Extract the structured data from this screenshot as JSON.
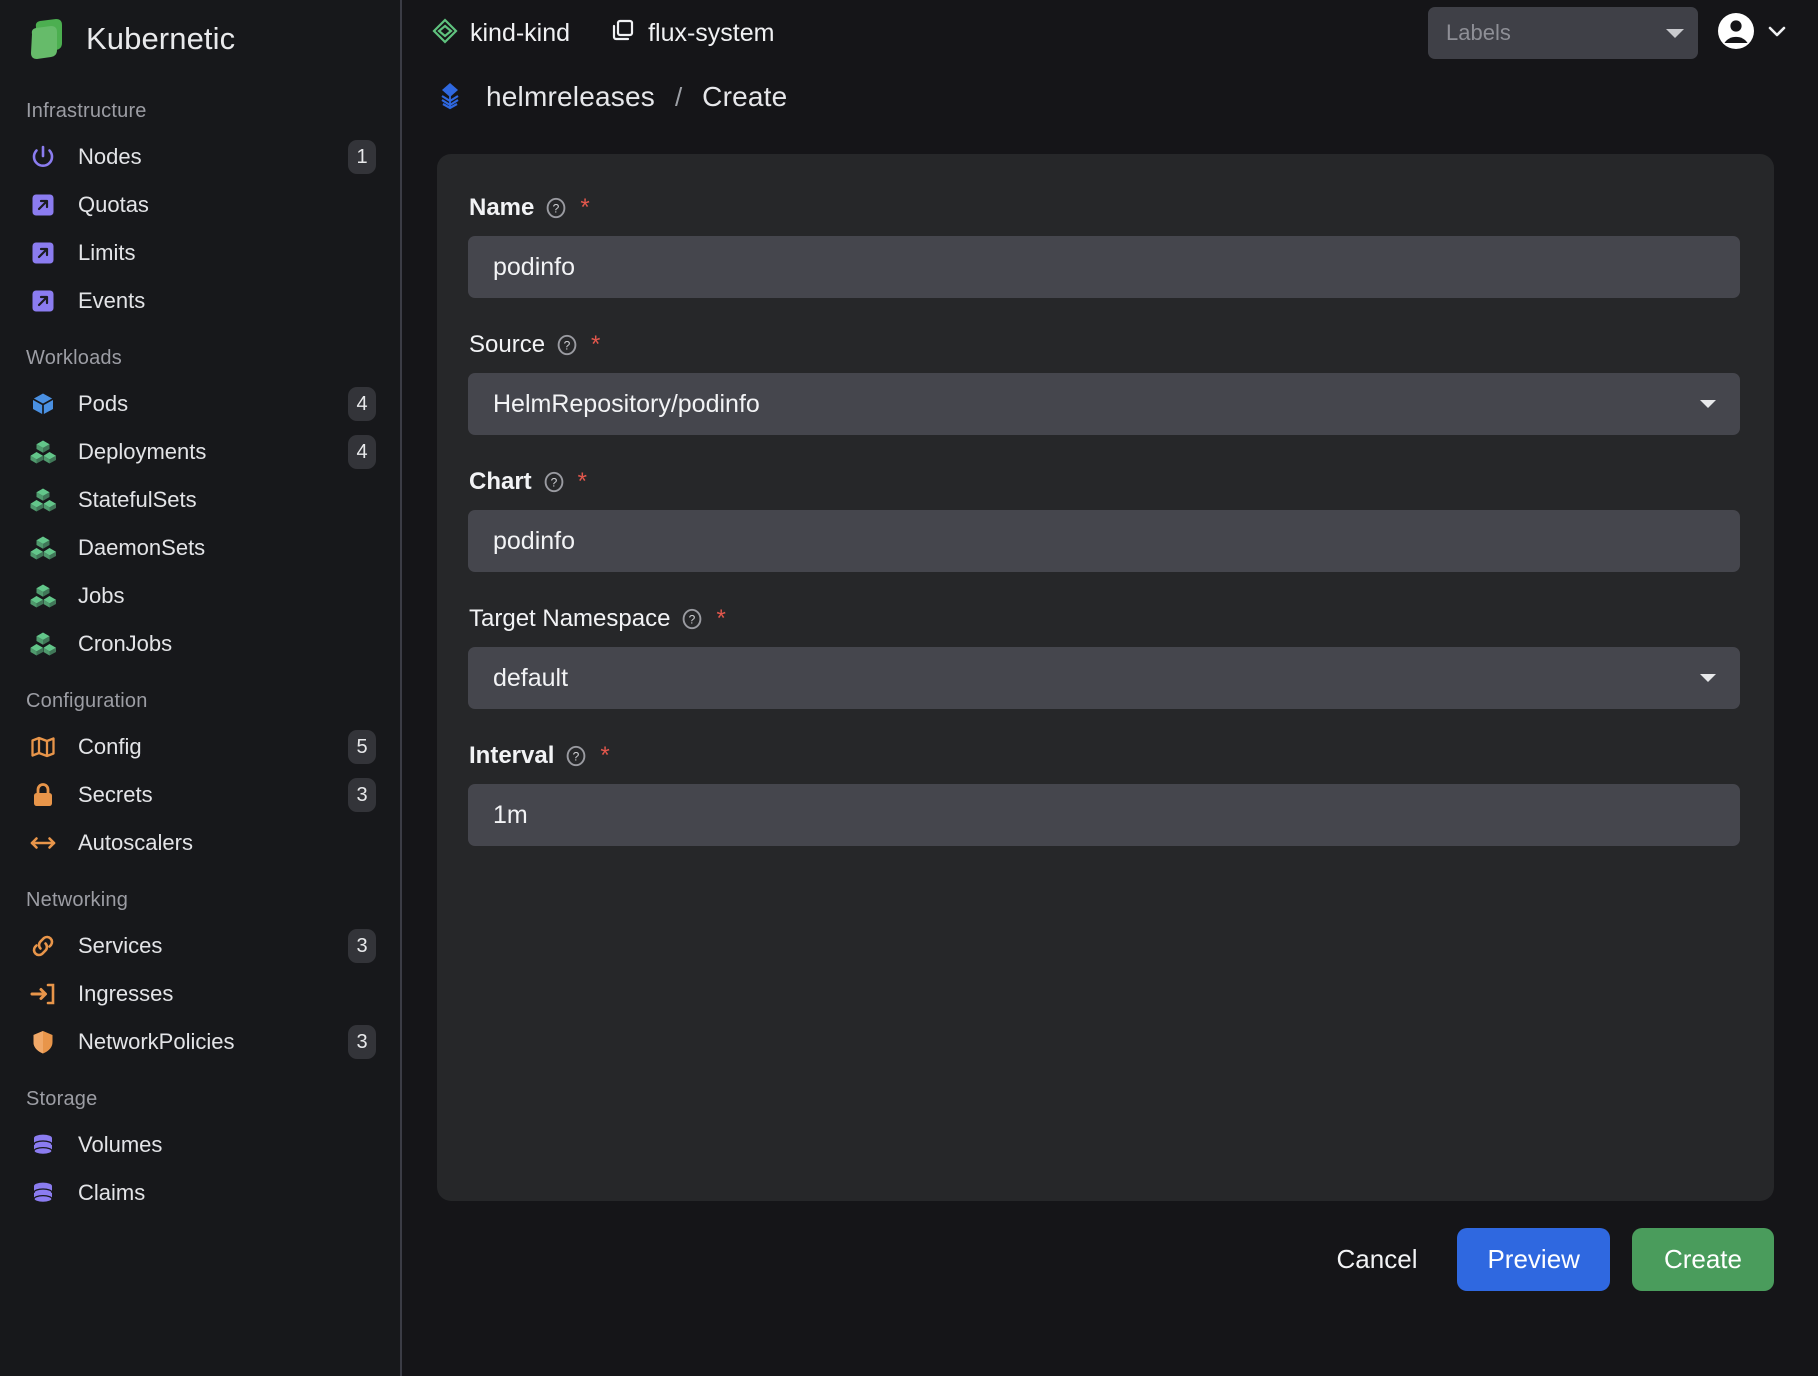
{
  "brand": {
    "title": "Kubernetic",
    "logo_icon": "kubernetic-logo-icon"
  },
  "sidebar": {
    "groups": [
      {
        "title": "Infrastructure",
        "items": [
          {
            "label": "Nodes",
            "badge": "1",
            "icon": "power-icon",
            "color": "#8b7cf0"
          },
          {
            "label": "Quotas",
            "badge": "",
            "icon": "arrow-up-right-box-icon",
            "color": "#8b7cf0"
          },
          {
            "label": "Limits",
            "badge": "",
            "icon": "arrow-up-right-box-icon",
            "color": "#8b7cf0"
          },
          {
            "label": "Events",
            "badge": "",
            "icon": "arrow-up-right-box-icon",
            "color": "#8b7cf0"
          }
        ]
      },
      {
        "title": "Workloads",
        "items": [
          {
            "label": "Pods",
            "badge": "4",
            "icon": "cube-icon",
            "color": "#4a90e2"
          },
          {
            "label": "Deployments",
            "badge": "4",
            "icon": "cubes-icon",
            "color": "#63c68a"
          },
          {
            "label": "StatefulSets",
            "badge": "",
            "icon": "cubes-icon",
            "color": "#63c68a"
          },
          {
            "label": "DaemonSets",
            "badge": "",
            "icon": "cubes-icon",
            "color": "#63c68a"
          },
          {
            "label": "Jobs",
            "badge": "",
            "icon": "cubes-icon",
            "color": "#63c68a"
          },
          {
            "label": "CronJobs",
            "badge": "",
            "icon": "cubes-icon",
            "color": "#63c68a"
          }
        ]
      },
      {
        "title": "Configuration",
        "items": [
          {
            "label": "Config",
            "badge": "5",
            "icon": "map-icon",
            "color": "#e8954a"
          },
          {
            "label": "Secrets",
            "badge": "3",
            "icon": "lock-icon",
            "color": "#e8954a"
          },
          {
            "label": "Autoscalers",
            "badge": "",
            "icon": "arrows-horizontal-icon",
            "color": "#e8954a"
          }
        ]
      },
      {
        "title": "Networking",
        "items": [
          {
            "label": "Services",
            "badge": "3",
            "icon": "link-icon",
            "color": "#e8954a"
          },
          {
            "label": "Ingresses",
            "badge": "",
            "icon": "arrow-into-bracket-icon",
            "color": "#e8954a"
          },
          {
            "label": "NetworkPolicies",
            "badge": "3",
            "icon": "shield-icon",
            "color": "#e8954a"
          }
        ]
      },
      {
        "title": "Storage",
        "items": [
          {
            "label": "Volumes",
            "badge": "",
            "icon": "database-icon",
            "color": "#8b7cf0"
          },
          {
            "label": "Claims",
            "badge": "",
            "icon": "database-icon",
            "color": "#8b7cf0"
          }
        ]
      }
    ]
  },
  "topbar": {
    "cluster": {
      "label": "kind-kind",
      "icon": "cluster-diamond-icon"
    },
    "namespace": {
      "label": "flux-system",
      "icon": "namespace-copy-icon"
    },
    "labels_filter": {
      "placeholder": "Labels",
      "value": "",
      "icon": "chevron-down-icon"
    },
    "account": {
      "icon": "account-circle-icon",
      "chevron": "chevron-down-icon"
    }
  },
  "breadcrumb": {
    "icon": "flux-logo-icon",
    "resource": "helmreleases",
    "separator": "/",
    "action": "Create"
  },
  "form": {
    "fields": [
      {
        "label": "Name",
        "bold": true,
        "required": "*",
        "type": "text",
        "value": "podinfo"
      },
      {
        "label": "Source",
        "bold": false,
        "required": "*",
        "type": "select",
        "value": "HelmRepository/podinfo"
      },
      {
        "label": "Chart",
        "bold": true,
        "required": "*",
        "type": "text",
        "value": "podinfo"
      },
      {
        "label": "Target Namespace",
        "bold": false,
        "required": "*",
        "type": "select",
        "value": "default"
      },
      {
        "label": "Interval",
        "bold": true,
        "required": "*",
        "type": "text",
        "value": "1m"
      }
    ]
  },
  "footer": {
    "cancel_label": "Cancel",
    "preview_label": "Preview",
    "create_label": "Create"
  },
  "colors": {
    "accent_blue": "#2f68e0",
    "accent_green": "#4a9c5c",
    "required_red": "#e2574c",
    "panel": "#262729",
    "input": "#45464d",
    "background": "#151518",
    "sidebar": "#17181b"
  }
}
